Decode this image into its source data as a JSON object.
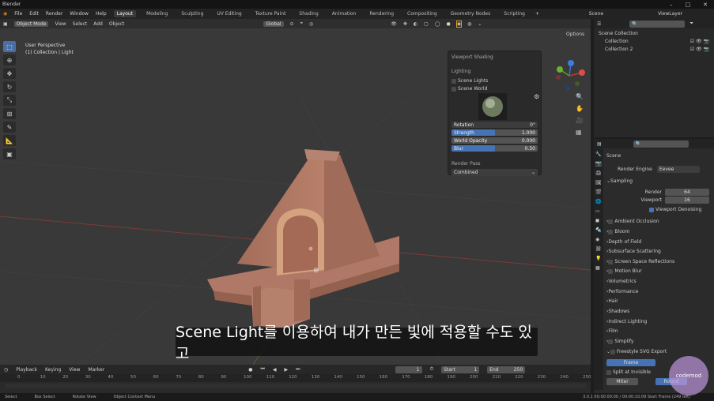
{
  "window": {
    "title": "Blender"
  },
  "menu": {
    "items": [
      "File",
      "Edit",
      "Render",
      "Window",
      "Help"
    ],
    "workspaces": [
      "Layout",
      "Modeling",
      "Sculpting",
      "UV Editing",
      "Texture Paint",
      "Shading",
      "Animation",
      "Rendering",
      "Compositing",
      "Geometry Nodes",
      "Scripting"
    ],
    "active_workspace": "Layout",
    "add_tab": "+",
    "scene_label": "Scene",
    "view_layer_label": "ViewLayer"
  },
  "viewport": {
    "mode": "Object Mode",
    "menu": [
      "View",
      "Select",
      "Add",
      "Object"
    ],
    "transform": "Global",
    "options": "Options",
    "info_line1": "User Perspective",
    "info_line2": "(1) Collection | Light"
  },
  "shading_popover": {
    "title": "Viewport Shading",
    "lighting_header": "Lighting",
    "scene_lights": {
      "label": "Scene Lights",
      "checked": false
    },
    "scene_world": {
      "label": "Scene World",
      "checked": false
    },
    "rotation": {
      "label": "Rotation",
      "value": "0°"
    },
    "strength": {
      "label": "Strength",
      "value": "1.000",
      "fill": 0.5
    },
    "world_opacity": {
      "label": "World Opacity",
      "value": "0.000",
      "fill": 0.0
    },
    "blur": {
      "label": "Blur",
      "value": "0.50",
      "fill": 0.5
    },
    "render_pass_header": "Render Pass",
    "render_pass_value": "Combined"
  },
  "subtitle": "Scene Light를 이용하여 내가 만든 빛에 적용할 수도 있고",
  "outliner": {
    "root": "Scene Collection",
    "items": [
      "Collection",
      "Collection 2"
    ]
  },
  "properties": {
    "scene_label": "Scene",
    "render_engine_label": "Render Engine",
    "render_engine_value": "Eevee",
    "sampling": "Sampling",
    "render_label": "Render",
    "render_value": "64",
    "viewport_label": "Viewport",
    "viewport_value": "16",
    "viewport_denoising": "Viewport Denoising",
    "panels": [
      "Ambient Occlusion",
      "Bloom",
      "Depth of Field",
      "Subsurface Scattering",
      "Screen Space Reflections",
      "Motion Blur",
      "Volumetrics",
      "Performance",
      "Hair",
      "Shadows",
      "Indirect Lighting",
      "Film",
      "Simplify",
      "Freestyle SVG Export"
    ],
    "frame_btn": "Frame",
    "split_invisible": "Split at Invisible",
    "miter": "Miter",
    "round": "Round"
  },
  "timeline": {
    "menu": [
      "Playback",
      "Keying",
      "View",
      "Marker"
    ],
    "current_frame": "1",
    "start_label": "Start",
    "start_value": "1",
    "end_label": "End",
    "end_value": "250",
    "ruler": [
      "0",
      "10",
      "20",
      "30",
      "40",
      "50",
      "60",
      "70",
      "80",
      "90",
      "100",
      "110",
      "120",
      "130",
      "140",
      "150",
      "160",
      "170",
      "180",
      "190",
      "200",
      "210",
      "220",
      "230",
      "240",
      "250"
    ]
  },
  "statusbar": {
    "items": [
      "Select",
      "Box Select",
      "Rotate View",
      "Object Context Menu"
    ],
    "version": "3.0.1  00:00:00:00 / 00:00:10:09  Start Frame (249 left)"
  },
  "watermark": "codemod"
}
